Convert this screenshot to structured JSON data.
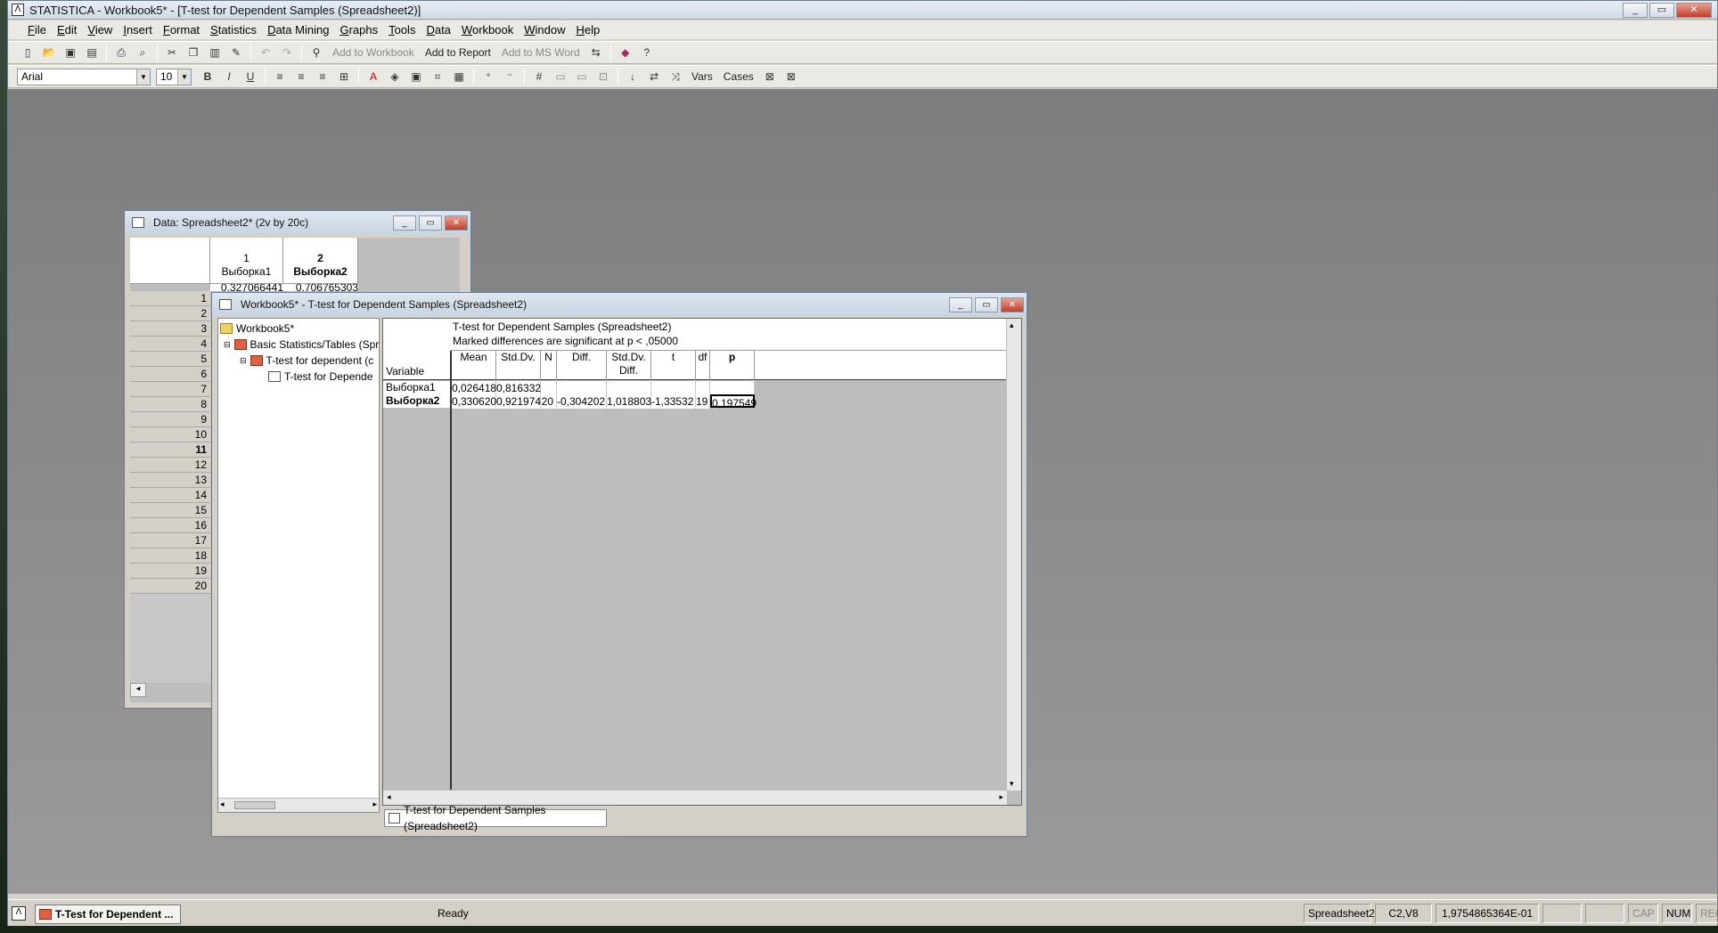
{
  "app": {
    "title": "STATISTICA - Workbook5* - [T-test for Dependent Samples (Spreadsheet2)]",
    "window_buttons": [
      "_",
      "▭",
      "✕"
    ]
  },
  "menu": [
    "File",
    "Edit",
    "View",
    "Insert",
    "Format",
    "Statistics",
    "Data Mining",
    "Graphs",
    "Tools",
    "Data",
    "Workbook",
    "Window",
    "Help"
  ],
  "toolbar": {
    "add_to_workbook": "Add to Workbook",
    "add_to_report": "Add to Report",
    "add_to_msword": "Add to MS Word",
    "vars": "Vars",
    "cases": "Cases"
  },
  "format_bar": {
    "font": "Arial",
    "size": "10",
    "bold": "B",
    "italic": "I",
    "underline": "U"
  },
  "data_window": {
    "title": "Data: Spreadsheet2* (2v by 20c)",
    "col_numbers": [
      "1",
      "2"
    ],
    "col_names": [
      "Выборка1",
      "Выборка2"
    ],
    "partial_row": [
      "0,327066441",
      "0,706765303"
    ],
    "row_numbers": [
      "1",
      "2",
      "3",
      "4",
      "5",
      "6",
      "7",
      "8",
      "9",
      "10",
      "11",
      "12",
      "13",
      "14",
      "15",
      "16",
      "17",
      "18",
      "19",
      "20"
    ],
    "active_row": "11"
  },
  "workbook_window": {
    "title": "Workbook5* - T-test for Dependent Samples (Spreadsheet2)",
    "tree": [
      "Workbook5*",
      "Basic Statistics/Tables (Spr",
      "T-test for dependent (c",
      "T-test for Depende"
    ],
    "results": {
      "title": "T-test for Dependent Samples (Spreadsheet2)",
      "subtitle": "Marked differences are significant at p < ,05000",
      "variable_header": "Variable",
      "headers": [
        "Mean",
        "Std.Dv.",
        "N",
        "Diff.",
        "Std.Dv.\nDiff.",
        "t",
        "df",
        "p"
      ],
      "rows": [
        {
          "var": "Выборка1",
          "cells": [
            "0,026418",
            "0,816332",
            "",
            "",
            "",
            "",
            "",
            ""
          ]
        },
        {
          "var": "Выборка2",
          "cells": [
            "0,330620",
            "0,921974",
            "20",
            "-0,304202",
            "1,018803",
            "-1,33532",
            "19",
            "0,197549"
          ]
        }
      ]
    },
    "tab": "T-test for Dependent Samples (Spreadsheet2)"
  },
  "status": {
    "ready": "Ready",
    "sheet": "Spreadsheet2",
    "cell": "C2,V8",
    "value": "1,9754865364E-01",
    "cap": "CAP",
    "num": "NUM",
    "rec": "REC"
  },
  "taskbar": {
    "item": "T-Test for Dependent ..."
  }
}
